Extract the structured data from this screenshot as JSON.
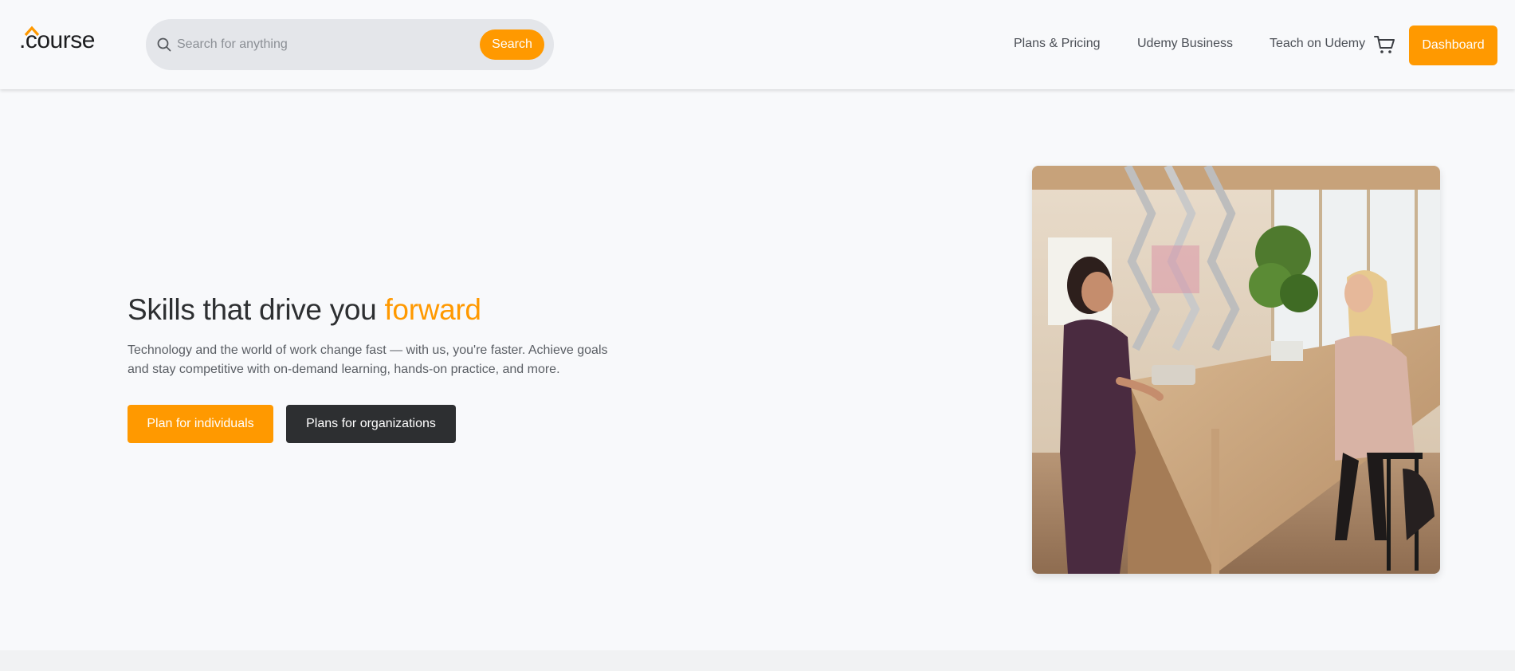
{
  "header": {
    "logo_text": ".course",
    "search": {
      "placeholder": "Search for anything",
      "value": "",
      "button_label": "Search"
    },
    "nav": {
      "plans_pricing": "Plans & Pricing",
      "business": "Udemy Business",
      "teach": "Teach on Udemy"
    },
    "cart_icon": "cart-icon",
    "dashboard_label": "Dashboard"
  },
  "hero": {
    "title_prefix": "Skills that drive you ",
    "title_accent": "forward",
    "description": "Technology and the world of work change fast — with us, you're faster. Achieve goals and stay competitive with on-demand learning, hands-on practice, and more.",
    "primary_cta": "Plan for individuals",
    "secondary_cta": "Plans for organizations"
  },
  "colors": {
    "accent": "#ff9900",
    "dark": "#2d2f31",
    "background": "#f8f9fb",
    "search_bg": "#e4e6ea"
  }
}
